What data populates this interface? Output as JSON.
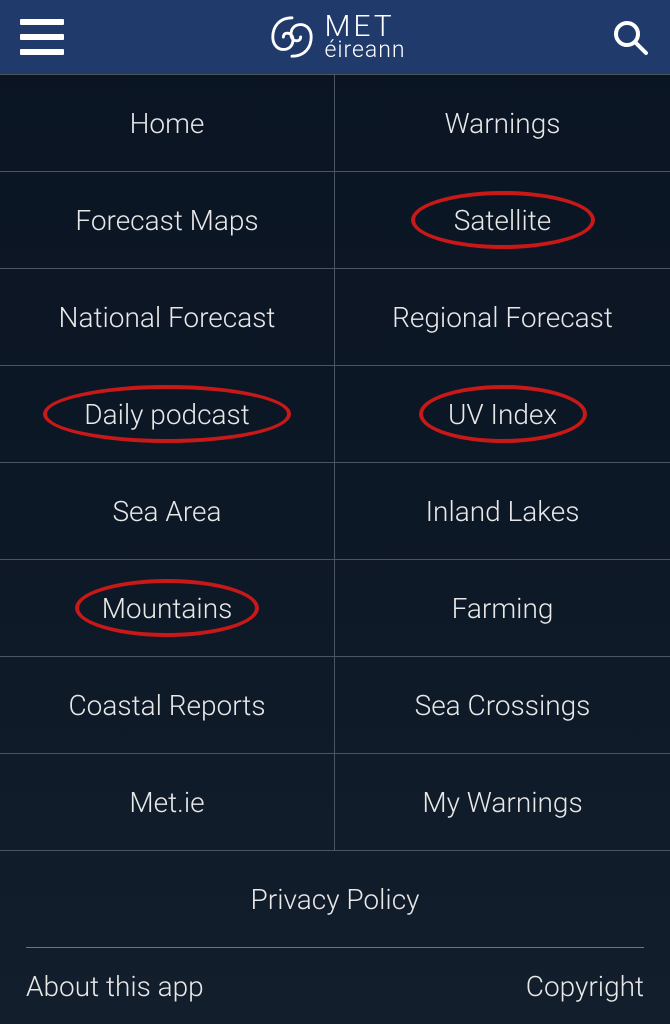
{
  "header": {
    "logo_top": "MET",
    "logo_bottom": "éireann"
  },
  "grid": [
    {
      "label": "Home",
      "circled": false
    },
    {
      "label": "Warnings",
      "circled": false
    },
    {
      "label": "Forecast Maps",
      "circled": false
    },
    {
      "label": "Satellite",
      "circled": true
    },
    {
      "label": "National Forecast",
      "circled": false
    },
    {
      "label": "Regional Forecast",
      "circled": false
    },
    {
      "label": "Daily podcast",
      "circled": true
    },
    {
      "label": "UV Index",
      "circled": true
    },
    {
      "label": "Sea Area",
      "circled": false
    },
    {
      "label": "Inland Lakes",
      "circled": false
    },
    {
      "label": "Mountains",
      "circled": true
    },
    {
      "label": "Farming",
      "circled": false
    },
    {
      "label": "Coastal Reports",
      "circled": false
    },
    {
      "label": "Sea Crossings",
      "circled": false
    },
    {
      "label": "Met.ie",
      "circled": false
    },
    {
      "label": "My Warnings",
      "circled": false
    }
  ],
  "footer": {
    "privacy": "Privacy Policy",
    "about": "About this app",
    "copyright": "Copyright"
  },
  "colors": {
    "header_bg": "#1f3a6b",
    "annotation": "#c91818"
  }
}
